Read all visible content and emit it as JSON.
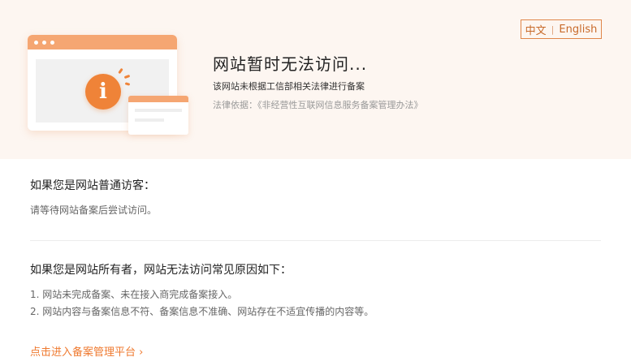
{
  "lang": {
    "zh": "中文",
    "sep": "|",
    "en": "English"
  },
  "header": {
    "title": "网站暂时无法访问...",
    "reason": "该网站未根据工信部相关法律进行备案",
    "law": "法律依据：《非经营性互联网信息服务备案管理办法》"
  },
  "visitor": {
    "title": "如果您是网站普通访客：",
    "text": "请等待网站备案后尝试访问。"
  },
  "owner": {
    "title": "如果您是网站所有者，网站无法访问常见原因如下：",
    "reasons": [
      "1. 网站未完成备案、未在接入商完成备案接入。",
      "2. 网站内容与备案信息不符、备案信息不准确、网站存在不适宜传播的内容等。"
    ]
  },
  "link": {
    "label": "点击进入备案管理平台 ›"
  },
  "icons": {
    "illustration": "info-icon"
  },
  "colors": {
    "accent": "#ef8338",
    "banner_bg": "#fdf6f1",
    "link": "#ef7a30"
  }
}
